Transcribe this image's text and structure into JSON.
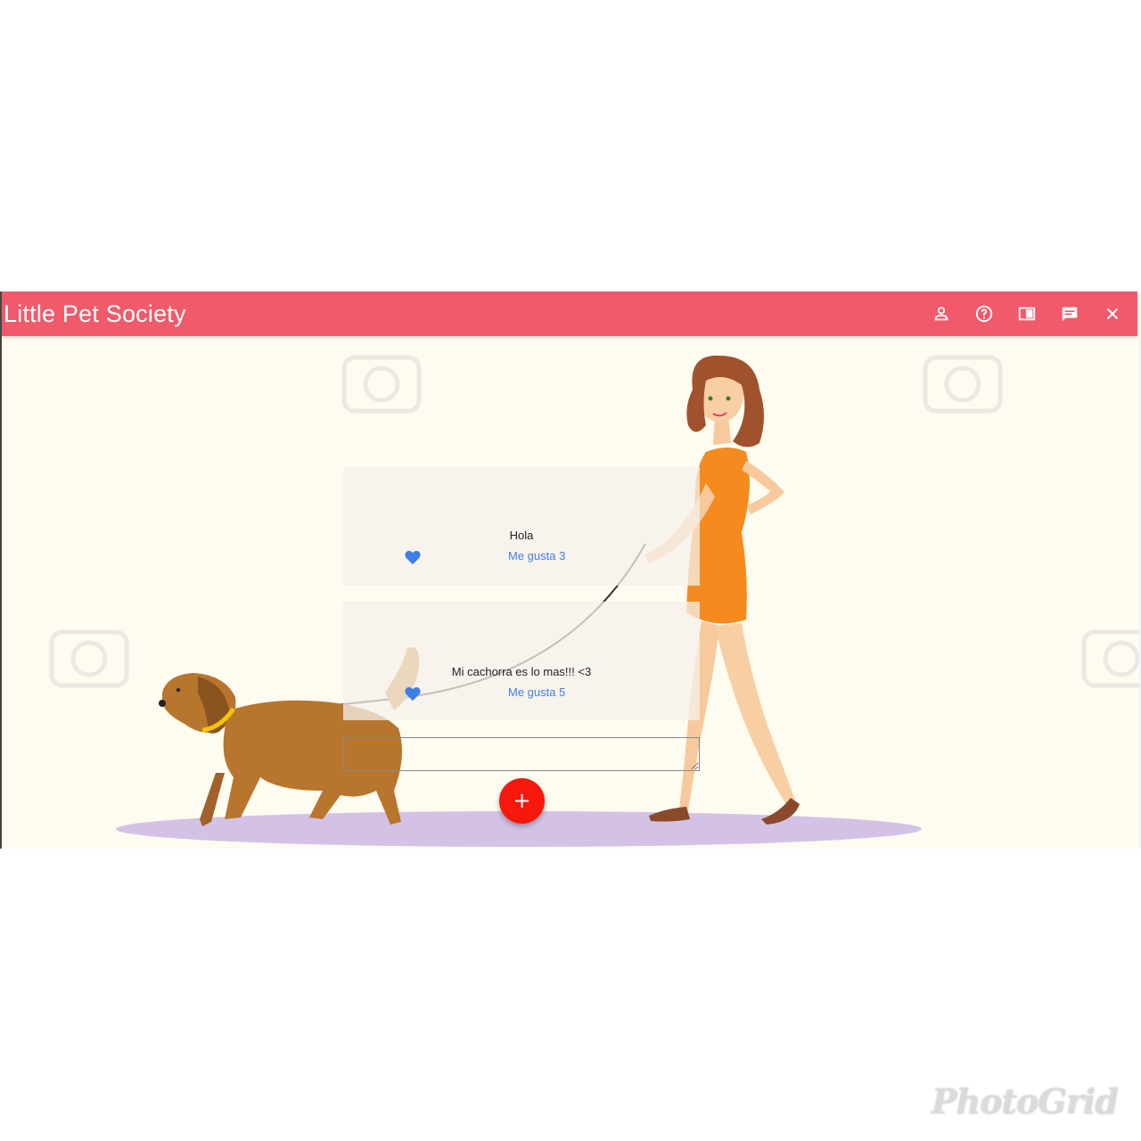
{
  "app": {
    "title": "Little Pet Society",
    "brand_color": "#f05a6a",
    "background_color": "#fefcf1"
  },
  "toolbar": {
    "actions": [
      {
        "icon": "account-icon"
      },
      {
        "icon": "help-icon"
      },
      {
        "icon": "side-panel-icon"
      },
      {
        "icon": "chat-icon"
      },
      {
        "icon": "close-icon"
      }
    ]
  },
  "posts": [
    {
      "text": "Hola",
      "like_label": "Me gusta 3"
    },
    {
      "text": "Mi cachorra es lo mas!!! <3",
      "like_label": "Me gusta 5"
    }
  ],
  "composer": {
    "value": "",
    "fab_label": "+",
    "fab_color": "#f6170d"
  },
  "like_color": "#3f7ee8",
  "overlay": {
    "watermark": "PhotoGrid"
  }
}
